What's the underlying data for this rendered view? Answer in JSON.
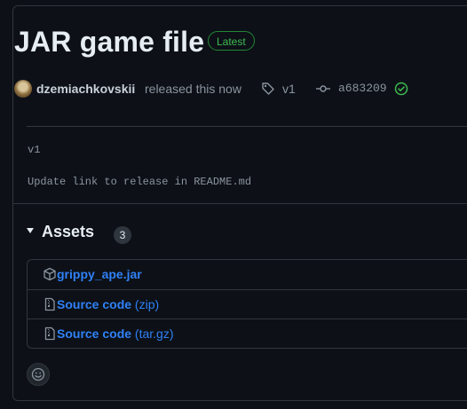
{
  "release": {
    "title": "JAR game file",
    "badge": "Latest",
    "author": "dzemiachkovskii",
    "action_text": "released this now",
    "tag": "v1",
    "commit": "a683209",
    "verified": true,
    "notes": [
      "v1",
      "Update link to release in README.md"
    ]
  },
  "assets": {
    "heading": "Assets",
    "count": "3",
    "items": [
      {
        "name": "grippy_ape.jar",
        "suffix": "",
        "icon": "package-icon"
      },
      {
        "name": "Source code",
        "suffix": "(zip)",
        "icon": "file-zip-icon"
      },
      {
        "name": "Source code",
        "suffix": "(tar.gz)",
        "icon": "file-zip-icon"
      }
    ]
  },
  "colors": {
    "background": "#0d1117",
    "border": "#30363d",
    "link": "#2f81f7",
    "success": "#3fb950",
    "muted": "#8b949e",
    "text": "#e6edf3"
  }
}
